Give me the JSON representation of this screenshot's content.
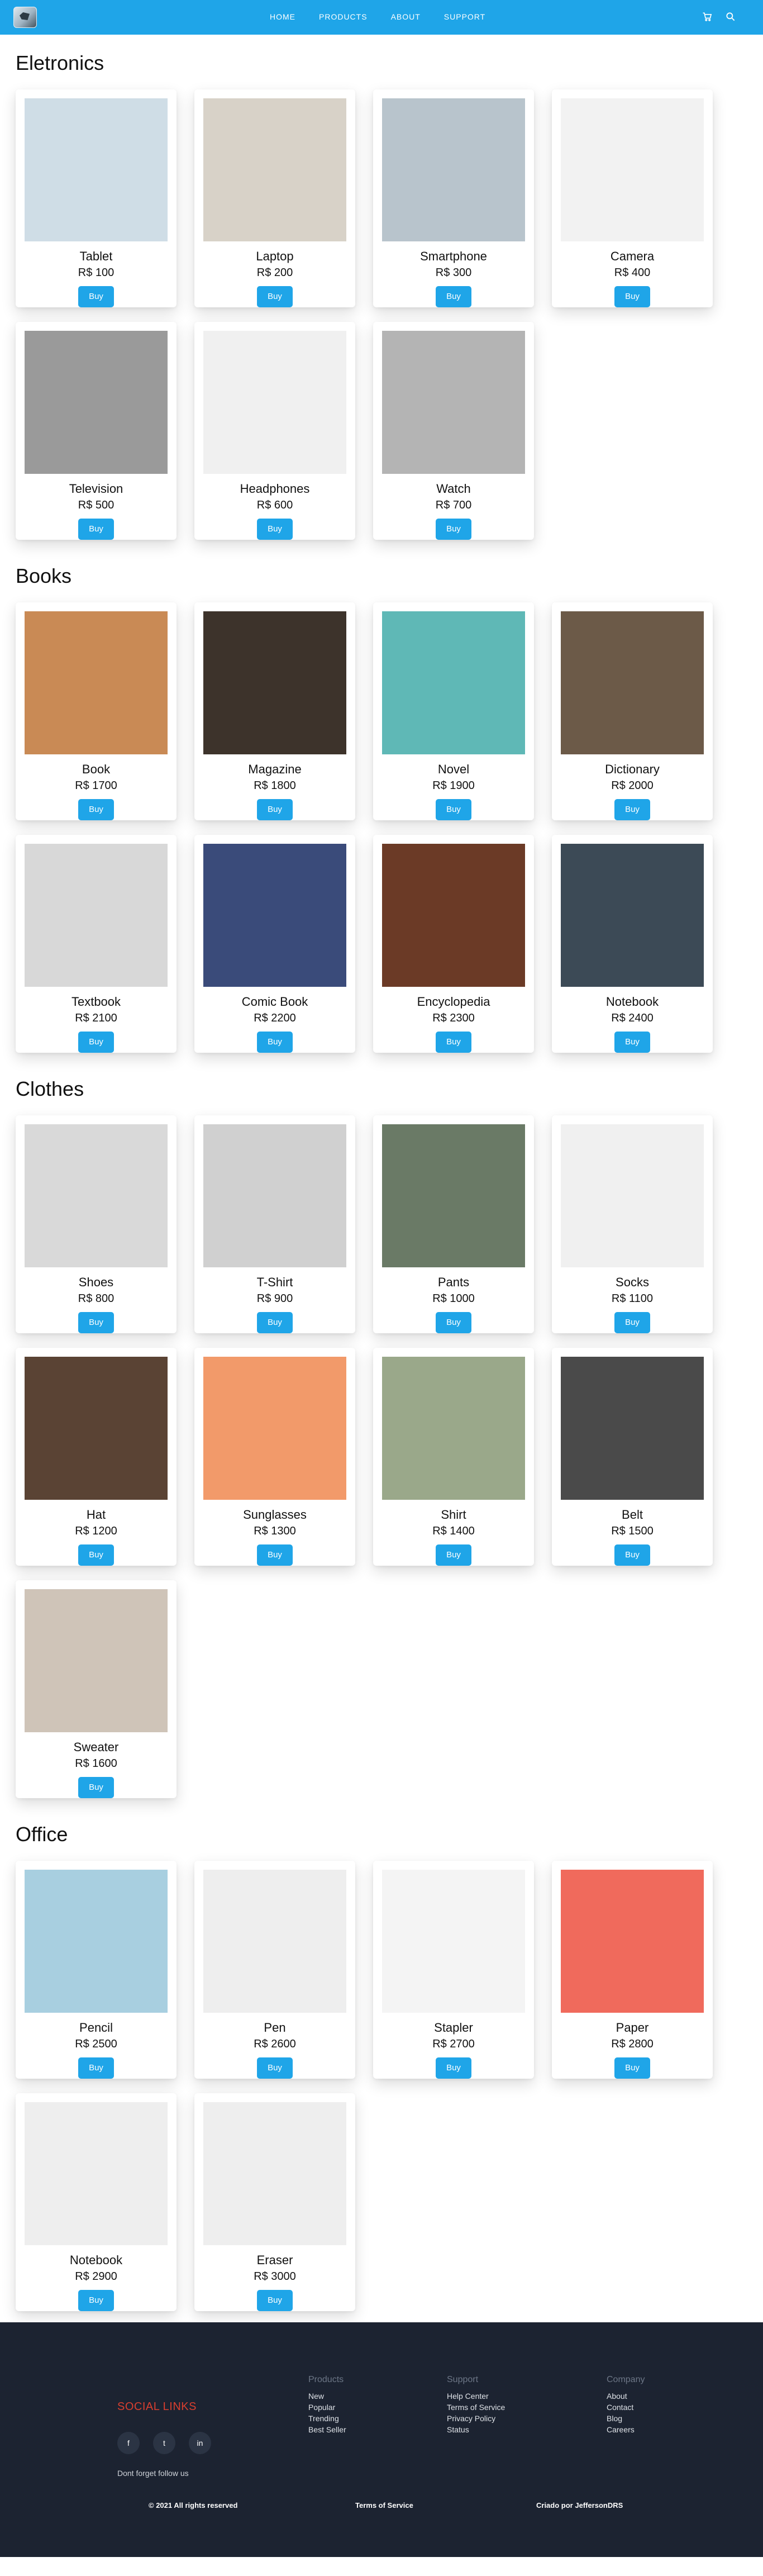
{
  "nav": {
    "links": [
      "HOME",
      "PRODUCTS",
      "ABOUT",
      "SUPPORT"
    ],
    "icons": [
      "cart-icon",
      "search-icon"
    ]
  },
  "colors": {
    "primary": "#1fa5e8",
    "footer_bg": "#1c2331",
    "social_title": "#d93f2f"
  },
  "categories": [
    {
      "title": "Eletronics",
      "products": [
        {
          "name": "Tablet",
          "price": "R$ 100",
          "button": "Buy"
        },
        {
          "name": "Laptop",
          "price": "R$ 200",
          "button": "Buy"
        },
        {
          "name": "Smartphone",
          "price": "R$ 300",
          "button": "Buy"
        },
        {
          "name": "Camera",
          "price": "R$ 400",
          "button": "Buy"
        },
        {
          "name": "Television",
          "price": "R$ 500",
          "button": "Buy"
        },
        {
          "name": "Headphones",
          "price": "R$ 600",
          "button": "Buy"
        },
        {
          "name": "Watch",
          "price": "R$ 700",
          "button": "Buy"
        }
      ]
    },
    {
      "title": "Books",
      "products": [
        {
          "name": "Book",
          "price": "R$ 1700",
          "button": "Buy"
        },
        {
          "name": "Magazine",
          "price": "R$ 1800",
          "button": "Buy"
        },
        {
          "name": "Novel",
          "price": "R$ 1900",
          "button": "Buy"
        },
        {
          "name": "Dictionary",
          "price": "R$ 2000",
          "button": "Buy"
        },
        {
          "name": "Textbook",
          "price": "R$ 2100",
          "button": "Buy"
        },
        {
          "name": "Comic Book",
          "price": "R$ 2200",
          "button": "Buy"
        },
        {
          "name": "Encyclopedia",
          "price": "R$ 2300",
          "button": "Buy"
        },
        {
          "name": "Notebook",
          "price": "R$ 2400",
          "button": "Buy"
        }
      ]
    },
    {
      "title": "Clothes",
      "products": [
        {
          "name": "Shoes",
          "price": "R$ 800",
          "button": "Buy"
        },
        {
          "name": "T-Shirt",
          "price": "R$ 900",
          "button": "Buy"
        },
        {
          "name": "Pants",
          "price": "R$ 1000",
          "button": "Buy"
        },
        {
          "name": "Socks",
          "price": "R$ 1100",
          "button": "Buy"
        },
        {
          "name": "Hat",
          "price": "R$ 1200",
          "button": "Buy"
        },
        {
          "name": "Sunglasses",
          "price": "R$ 1300",
          "button": "Buy"
        },
        {
          "name": "Shirt",
          "price": "R$ 1400",
          "button": "Buy"
        },
        {
          "name": "Belt",
          "price": "R$ 1500",
          "button": "Buy"
        },
        {
          "name": "Sweater",
          "price": "R$ 1600",
          "button": "Buy"
        }
      ]
    },
    {
      "title": "Office",
      "products": [
        {
          "name": "Pencil",
          "price": "R$ 2500",
          "button": "Buy"
        },
        {
          "name": "Pen",
          "price": "R$ 2600",
          "button": "Buy"
        },
        {
          "name": "Stapler",
          "price": "R$ 2700",
          "button": "Buy"
        },
        {
          "name": "Paper",
          "price": "R$ 2800",
          "button": "Buy"
        },
        {
          "name": "Notebook",
          "price": "R$ 2900",
          "button": "Buy"
        },
        {
          "name": "Eraser",
          "price": "R$ 3000",
          "button": "Buy"
        }
      ]
    }
  ],
  "footer": {
    "social_title": "SOCIAL LINKS",
    "social_icons": [
      "f",
      "t",
      "in"
    ],
    "social_note": "Dont forget follow us",
    "columns": [
      {
        "title": "Products",
        "items": [
          "New",
          "Popular",
          "Trending",
          "Best Seller"
        ]
      },
      {
        "title": "Support",
        "items": [
          "Help Center",
          "Terms of Service",
          "Privacy Policy",
          "Status"
        ]
      },
      {
        "title": "Company",
        "items": [
          "About",
          "Contact",
          "Blog",
          "Careers"
        ]
      }
    ],
    "copyright": "© 2021 All rights reserved",
    "terms": "Terms of Service",
    "credit": "Criado por JeffersonDRS"
  }
}
